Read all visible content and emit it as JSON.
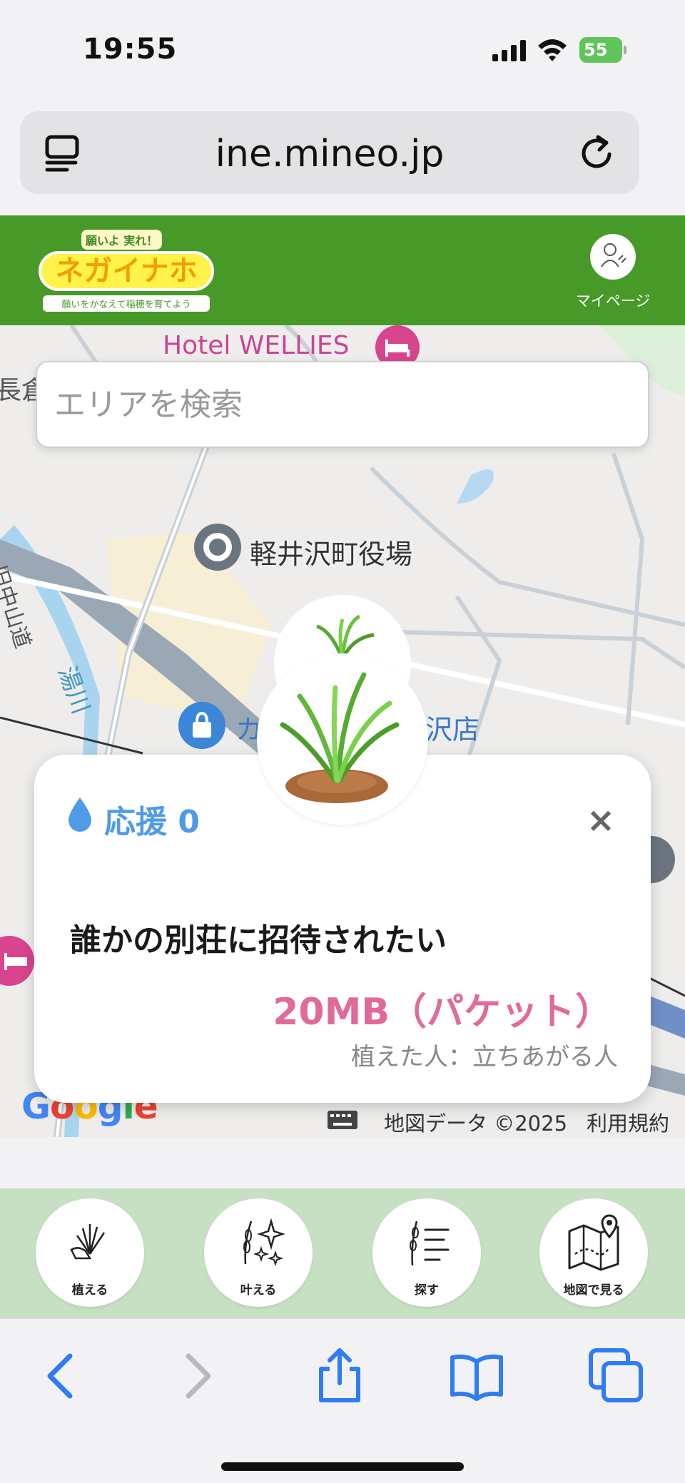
{
  "status_bar": {
    "time": "19:55",
    "battery": "55"
  },
  "browser": {
    "url": "ine.mineo.jp"
  },
  "header": {
    "logo_top": "願いよ 実れ！",
    "logo_main": "ネガイナホ",
    "logo_sub": "願いをかなえて稲穂を育てよう",
    "mypage_label": "マイページ"
  },
  "search": {
    "placeholder": "エリアを検索"
  },
  "map": {
    "labels": {
      "hotel": "Hotel WELLIES",
      "town_hall": "軽井沢町役場",
      "shop": "カ　　　　　　沢店",
      "road1": "旧中山道",
      "road2": "湯川",
      "left": "長倉"
    },
    "google": "Google",
    "map_data": "地図データ ©2025",
    "terms": "利用規約"
  },
  "card": {
    "support_label": "応援 0",
    "wish": "誰かの別荘に招待されたい",
    "reward": "20MB（パケット）",
    "planter": "植えた人：立ちあがる人"
  },
  "bottom_nav": [
    {
      "label": "植える",
      "icon": "plant-icon"
    },
    {
      "label": "叶える",
      "icon": "sparkle-wheat-icon"
    },
    {
      "label": "探す",
      "icon": "search-list-icon"
    },
    {
      "label": "地図で見る",
      "icon": "map-icon"
    }
  ]
}
